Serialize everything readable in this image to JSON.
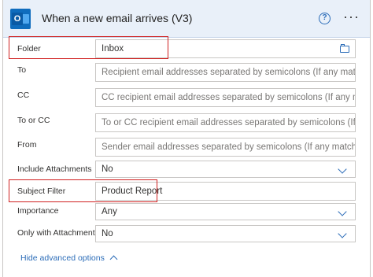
{
  "header": {
    "title": "When a new email arrives (V3)",
    "app_icon_letter": "O",
    "help_glyph": "?",
    "more_glyph": "···"
  },
  "fields": {
    "folder": {
      "label": "Folder",
      "value": "Inbox"
    },
    "to": {
      "label": "To",
      "placeholder": "Recipient email addresses separated by semicolons (If any match, the"
    },
    "cc": {
      "label": "CC",
      "placeholder": "CC recipient email addresses separated by semicolons (If any match,"
    },
    "to_or_cc": {
      "label": "To or CC",
      "placeholder": "To or CC recipient email addresses separated by semicolons (If any m"
    },
    "from": {
      "label": "From",
      "placeholder": "Sender email addresses separated by semicolons (If any match, the tr"
    },
    "include_attachments": {
      "label": "Include Attachments",
      "value": "No"
    },
    "subject_filter": {
      "label": "Subject Filter",
      "value": "Product Report"
    },
    "importance": {
      "label": "Importance",
      "value": "Any"
    },
    "only_with_attachments": {
      "label": "Only with Attachments",
      "value": "No"
    }
  },
  "advanced_link": {
    "label": "Hide advanced options"
  },
  "colors": {
    "accent": "#2b6cb8",
    "highlight": "#d02020",
    "header_bg": "#e9f0f9"
  }
}
